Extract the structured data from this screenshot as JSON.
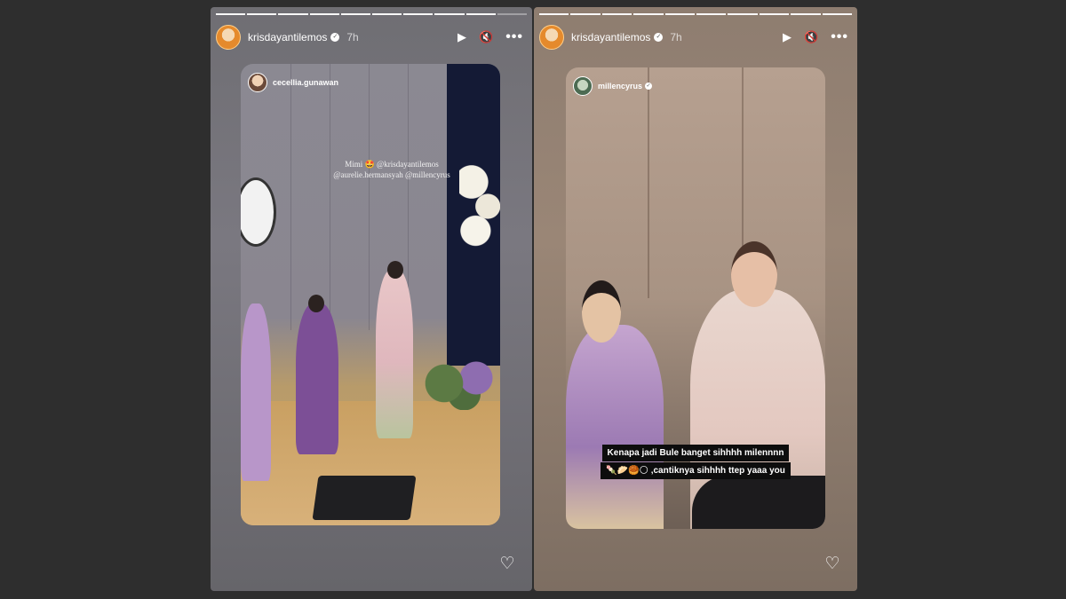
{
  "stories": [
    {
      "username": "krisdayantilemos",
      "time": "7h",
      "card_username": "cecellia.gunawan",
      "mention_line_1": "Mimi 🤩 @krisdayantilemos",
      "mention_line_2": "@aurelie.hermansyah @millencyrus",
      "progress_done": 9,
      "progress_total": 10
    },
    {
      "username": "krisdayantilemos",
      "time": "7h",
      "card_username": "millencyrus",
      "caption_line_1": "Kenapa jadi Bule banget sihhhh milennnn",
      "caption_line_2": "🍡🥟🥮🌕 ,cantiknya sihhhh ttep yaaa you",
      "progress_done": 10,
      "progress_total": 10
    }
  ],
  "icons": {
    "play": "▶",
    "mute": "🔇",
    "more": "•••",
    "heart": "♡",
    "verified": "✓"
  },
  "colors": {
    "page_background": "#2e2e2e",
    "caption_background": "#0d0d0d"
  }
}
